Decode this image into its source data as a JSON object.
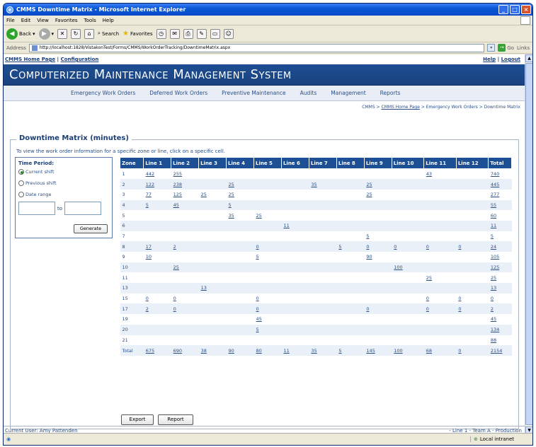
{
  "window": {
    "title": "CMMS Downtime Matrix - Microsoft Internet Explorer"
  },
  "menu": [
    "File",
    "Edit",
    "View",
    "Favorites",
    "Tools",
    "Help"
  ],
  "toolbar": {
    "back_label": "Back",
    "search_label": "Search",
    "favorites_label": "Favorites"
  },
  "address": {
    "label": "Address",
    "url": "http://localhost:1828/VistakonTest/Forms/CMMS/WorkOrderTracking/DowntimeMatrix.aspx",
    "go_label": "Go",
    "links_label": "Links"
  },
  "top_links": {
    "home": "CMMS Home Page",
    "sep": " | ",
    "config": "Configuration",
    "help": "Help",
    "logout": "Logout"
  },
  "banner": {
    "title": "Computerized Maintenance Management System"
  },
  "nav": [
    "Emergency Work Orders",
    "Deferred Work Orders",
    "Preventive Maintenance",
    "Audits",
    "Management",
    "Reports"
  ],
  "breadcrumb": {
    "prefix": "CMMS > ",
    "home": "CMMS Home Page",
    "suffix": " > Emergency Work Orders > Downtime Matrix"
  },
  "matrix": {
    "title": "Downtime Matrix (minutes)",
    "instruction": "To view the work order information for a specific zone or line, click on a specific cell.",
    "time_period": {
      "heading": "Time Period:",
      "options": [
        "Current shift",
        "Previous shift",
        "Date range"
      ],
      "selected": "Current shift",
      "to_label": "to",
      "generate_label": "Generate"
    },
    "columns": [
      "Zone",
      "Line 1",
      "Line 2",
      "Line 3",
      "Line 4",
      "Line 5",
      "Line 6",
      "Line 7",
      "Line 8",
      "Line 9",
      "Line 10",
      "Line 11",
      "Line 12",
      "Total"
    ],
    "rows": [
      [
        "1",
        "442",
        "255",
        "",
        "",
        "",
        "",
        "",
        "",
        "",
        "",
        "43",
        "",
        "740"
      ],
      [
        "2",
        "122",
        "238",
        "",
        "25",
        "",
        "",
        "35",
        "",
        "25",
        "",
        "",
        "",
        "445"
      ],
      [
        "3",
        "77",
        "125",
        "25",
        "25",
        "",
        "",
        "",
        "",
        "25",
        "",
        "",
        "",
        "277"
      ],
      [
        "4",
        "5",
        "45",
        "",
        "5",
        "",
        "",
        "",
        "",
        "",
        "",
        "",
        "",
        "55"
      ],
      [
        "5",
        "",
        "",
        "",
        "35",
        "25",
        "",
        "",
        "",
        "",
        "",
        "",
        "",
        "60"
      ],
      [
        "6",
        "",
        "",
        "",
        "",
        "",
        "11",
        "",
        "",
        "",
        "",
        "",
        "",
        "11"
      ],
      [
        "7",
        "",
        "",
        "",
        "",
        "",
        "",
        "",
        "",
        "5",
        "",
        "",
        "",
        "5"
      ],
      [
        "8",
        "17",
        "2",
        "",
        "",
        "0",
        "",
        "",
        "5",
        "0",
        "0",
        "0",
        "0",
        "24"
      ],
      [
        "9",
        "10",
        "",
        "",
        "",
        "5",
        "",
        "",
        "",
        "90",
        "",
        "",
        "",
        "105"
      ],
      [
        "10",
        "",
        "25",
        "",
        "",
        "",
        "",
        "",
        "",
        "",
        "100",
        "",
        "",
        "125"
      ],
      [
        "11",
        "",
        "",
        "",
        "",
        "",
        "",
        "",
        "",
        "",
        "",
        "25",
        "",
        "25"
      ],
      [
        "13",
        "",
        "",
        "13",
        "",
        "",
        "",
        "",
        "",
        "",
        "",
        "",
        "",
        "13"
      ],
      [
        "15",
        "0",
        "0",
        "",
        "",
        "0",
        "",
        "",
        "",
        "",
        "",
        "0",
        "0",
        "0"
      ],
      [
        "17",
        "2",
        "0",
        "",
        "",
        "0",
        "",
        "",
        "",
        "0",
        "",
        "0",
        "0",
        "2"
      ],
      [
        "19",
        "",
        "",
        "",
        "",
        "45",
        "",
        "",
        "",
        "",
        "",
        "",
        "",
        "45"
      ],
      [
        "20",
        "",
        "",
        "",
        "",
        "5",
        "",
        "",
        "",
        "",
        "",
        "",
        "",
        "134"
      ],
      [
        "21",
        "",
        "",
        "",
        "",
        "",
        "",
        "",
        "",
        "",
        "",
        "",
        "",
        "88"
      ],
      [
        "Total",
        "675",
        "690",
        "38",
        "90",
        "80",
        "11",
        "35",
        "5",
        "145",
        "100",
        "68",
        "0",
        "2154"
      ]
    ],
    "export_label": "Export",
    "report_label": "Report"
  },
  "footer": {
    "current_user": "Current User: Amy Pattenden",
    "context": "- Line 1 - Team A - Production"
  },
  "status": {
    "zone": "Local intranet"
  }
}
